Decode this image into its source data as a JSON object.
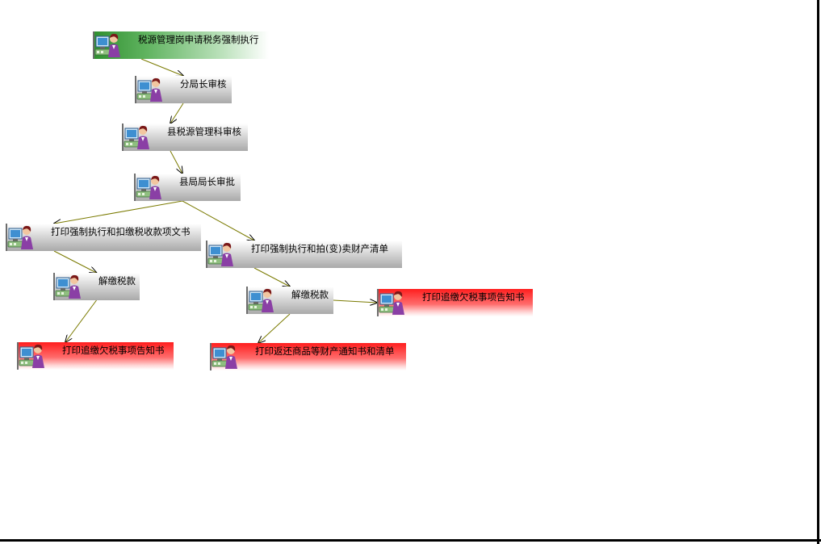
{
  "diagram": {
    "nodes": [
      {
        "id": "n1",
        "label": "税源管理岗申请税务强制执行",
        "style": "green"
      },
      {
        "id": "n2",
        "label": "分局长审核",
        "style": "gray"
      },
      {
        "id": "n3",
        "label": "县税源管理科审核",
        "style": "gray"
      },
      {
        "id": "n4",
        "label": "县局局长审批",
        "style": "gray"
      },
      {
        "id": "n5",
        "label": "打印强制执行和扣缴税收款项文书",
        "style": "gray"
      },
      {
        "id": "n6",
        "label": "打印强制执行和拍(变)卖财产清单",
        "style": "gray"
      },
      {
        "id": "n7",
        "label": "解缴税款",
        "style": "gray"
      },
      {
        "id": "n8",
        "label": "解缴税款",
        "style": "gray"
      },
      {
        "id": "n9",
        "label": "打印追缴欠税事项告知书",
        "style": "red"
      },
      {
        "id": "n10",
        "label": "打印追缴欠税事项告知书",
        "style": "red"
      },
      {
        "id": "n11",
        "label": "打印返还商品等财产通知书和清单",
        "style": "red"
      }
    ],
    "edges": [
      {
        "from": "n1",
        "to": "n2"
      },
      {
        "from": "n2",
        "to": "n3"
      },
      {
        "from": "n3",
        "to": "n4"
      },
      {
        "from": "n4",
        "to": "n5"
      },
      {
        "from": "n4",
        "to": "n6"
      },
      {
        "from": "n5",
        "to": "n7"
      },
      {
        "from": "n7",
        "to": "n10"
      },
      {
        "from": "n6",
        "to": "n8"
      },
      {
        "from": "n8",
        "to": "n9"
      },
      {
        "from": "n8",
        "to": "n11"
      }
    ],
    "colors": {
      "start": "#2f8f2f",
      "step": "#a9a9a9",
      "end": "#ff1e1e",
      "edge": "#7a7a00"
    }
  }
}
